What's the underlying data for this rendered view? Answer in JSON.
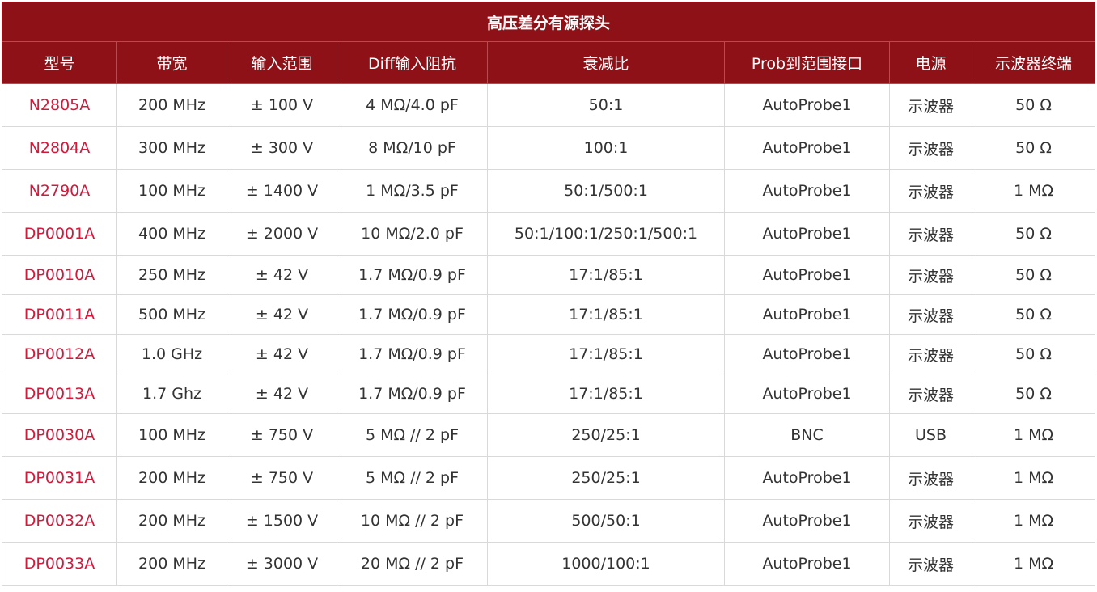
{
  "table": {
    "title": "高压差分有源探头",
    "headers": [
      "型号",
      "带宽",
      "输入范围",
      "Diff输入阻抗",
      "衰减比",
      "Prob到范围接口",
      "电源",
      "示波器终端"
    ],
    "rows": [
      [
        "N2805A",
        "200 MHz",
        "± 100 V",
        "4 MΩ/4.0 pF",
        "50:1",
        "AutoProbe1",
        "示波器",
        "50 Ω"
      ],
      [
        "N2804A",
        "300 MHz",
        "± 300 V",
        "8 MΩ/10 pF",
        "100:1",
        "AutoProbe1",
        "示波器",
        "50 Ω"
      ],
      [
        "N2790A",
        "100 MHz",
        "± 1400 V",
        "1 MΩ/3.5 pF",
        "50:1/500:1",
        "AutoProbe1",
        "示波器",
        "1 MΩ"
      ],
      [
        "DP0001A",
        "400 MHz",
        "± 2000 V",
        "10 MΩ/2.0 pF",
        "50:1/100:1/250:1/500:1",
        "AutoProbe1",
        "示波器",
        "50 Ω"
      ],
      [
        "DP0010A",
        "250 MHz",
        "± 42 V",
        "1.7 MΩ/0.9 pF",
        "17:1/85:1",
        "AutoProbe1",
        "示波器",
        "50 Ω"
      ],
      [
        "DP0011A",
        "500 MHz",
        "± 42 V",
        "1.7 MΩ/0.9 pF",
        "17:1/85:1",
        "AutoProbe1",
        "示波器",
        "50 Ω"
      ],
      [
        "DP0012A",
        "1.0 GHz",
        "± 42 V",
        "1.7 MΩ/0.9 pF",
        "17:1/85:1",
        "AutoProbe1",
        "示波器",
        "50 Ω"
      ],
      [
        "DP0013A",
        "1.7 Ghz",
        "± 42 V",
        "1.7 MΩ/0.9 pF",
        "17:1/85:1",
        "AutoProbe1",
        "示波器",
        "50 Ω"
      ],
      [
        "DP0030A",
        "100 MHz",
        "± 750 V",
        "5 MΩ // 2 pF",
        "250/25:1",
        "BNC",
        "USB",
        "1 MΩ"
      ],
      [
        "DP0031A",
        "200 MHz",
        "± 750 V",
        "5 MΩ // 2 pF",
        "250/25:1",
        "AutoProbe1",
        "示波器",
        "1 MΩ"
      ],
      [
        "DP0032A",
        "200 MHz",
        "± 1500 V",
        "10 MΩ // 2 pF",
        "500/50:1",
        "AutoProbe1",
        "示波器",
        "1 MΩ"
      ],
      [
        "DP0033A",
        "200 MHz",
        "± 3000 V",
        "20 MΩ // 2 pF",
        "1000/100:1",
        "AutoProbe1",
        "示波器",
        "1 MΩ"
      ]
    ],
    "colors": {
      "header_bg": "#8e1118",
      "header_text": "#ffffff",
      "model_text": "#d6183a",
      "body_text": "#333333",
      "border": "#d9d9d9"
    }
  }
}
